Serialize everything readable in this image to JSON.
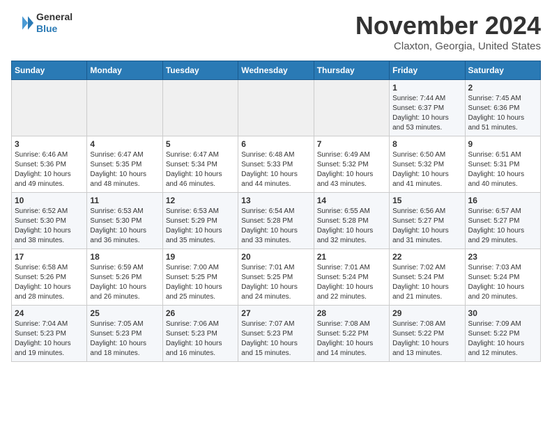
{
  "header": {
    "logo_line1": "General",
    "logo_line2": "Blue",
    "month": "November 2024",
    "location": "Claxton, Georgia, United States"
  },
  "weekdays": [
    "Sunday",
    "Monday",
    "Tuesday",
    "Wednesday",
    "Thursday",
    "Friday",
    "Saturday"
  ],
  "weeks": [
    [
      {
        "day": "",
        "empty": true
      },
      {
        "day": "",
        "empty": true
      },
      {
        "day": "",
        "empty": true
      },
      {
        "day": "",
        "empty": true
      },
      {
        "day": "",
        "empty": true
      },
      {
        "day": "1",
        "sunrise": "Sunrise: 7:44 AM",
        "sunset": "Sunset: 6:37 PM",
        "daylight": "Daylight: 10 hours and 53 minutes."
      },
      {
        "day": "2",
        "sunrise": "Sunrise: 7:45 AM",
        "sunset": "Sunset: 6:36 PM",
        "daylight": "Daylight: 10 hours and 51 minutes."
      }
    ],
    [
      {
        "day": "3",
        "sunrise": "Sunrise: 6:46 AM",
        "sunset": "Sunset: 5:36 PM",
        "daylight": "Daylight: 10 hours and 49 minutes."
      },
      {
        "day": "4",
        "sunrise": "Sunrise: 6:47 AM",
        "sunset": "Sunset: 5:35 PM",
        "daylight": "Daylight: 10 hours and 48 minutes."
      },
      {
        "day": "5",
        "sunrise": "Sunrise: 6:47 AM",
        "sunset": "Sunset: 5:34 PM",
        "daylight": "Daylight: 10 hours and 46 minutes."
      },
      {
        "day": "6",
        "sunrise": "Sunrise: 6:48 AM",
        "sunset": "Sunset: 5:33 PM",
        "daylight": "Daylight: 10 hours and 44 minutes."
      },
      {
        "day": "7",
        "sunrise": "Sunrise: 6:49 AM",
        "sunset": "Sunset: 5:32 PM",
        "daylight": "Daylight: 10 hours and 43 minutes."
      },
      {
        "day": "8",
        "sunrise": "Sunrise: 6:50 AM",
        "sunset": "Sunset: 5:32 PM",
        "daylight": "Daylight: 10 hours and 41 minutes."
      },
      {
        "day": "9",
        "sunrise": "Sunrise: 6:51 AM",
        "sunset": "Sunset: 5:31 PM",
        "daylight": "Daylight: 10 hours and 40 minutes."
      }
    ],
    [
      {
        "day": "10",
        "sunrise": "Sunrise: 6:52 AM",
        "sunset": "Sunset: 5:30 PM",
        "daylight": "Daylight: 10 hours and 38 minutes."
      },
      {
        "day": "11",
        "sunrise": "Sunrise: 6:53 AM",
        "sunset": "Sunset: 5:30 PM",
        "daylight": "Daylight: 10 hours and 36 minutes."
      },
      {
        "day": "12",
        "sunrise": "Sunrise: 6:53 AM",
        "sunset": "Sunset: 5:29 PM",
        "daylight": "Daylight: 10 hours and 35 minutes."
      },
      {
        "day": "13",
        "sunrise": "Sunrise: 6:54 AM",
        "sunset": "Sunset: 5:28 PM",
        "daylight": "Daylight: 10 hours and 33 minutes."
      },
      {
        "day": "14",
        "sunrise": "Sunrise: 6:55 AM",
        "sunset": "Sunset: 5:28 PM",
        "daylight": "Daylight: 10 hours and 32 minutes."
      },
      {
        "day": "15",
        "sunrise": "Sunrise: 6:56 AM",
        "sunset": "Sunset: 5:27 PM",
        "daylight": "Daylight: 10 hours and 31 minutes."
      },
      {
        "day": "16",
        "sunrise": "Sunrise: 6:57 AM",
        "sunset": "Sunset: 5:27 PM",
        "daylight": "Daylight: 10 hours and 29 minutes."
      }
    ],
    [
      {
        "day": "17",
        "sunrise": "Sunrise: 6:58 AM",
        "sunset": "Sunset: 5:26 PM",
        "daylight": "Daylight: 10 hours and 28 minutes."
      },
      {
        "day": "18",
        "sunrise": "Sunrise: 6:59 AM",
        "sunset": "Sunset: 5:26 PM",
        "daylight": "Daylight: 10 hours and 26 minutes."
      },
      {
        "day": "19",
        "sunrise": "Sunrise: 7:00 AM",
        "sunset": "Sunset: 5:25 PM",
        "daylight": "Daylight: 10 hours and 25 minutes."
      },
      {
        "day": "20",
        "sunrise": "Sunrise: 7:01 AM",
        "sunset": "Sunset: 5:25 PM",
        "daylight": "Daylight: 10 hours and 24 minutes."
      },
      {
        "day": "21",
        "sunrise": "Sunrise: 7:01 AM",
        "sunset": "Sunset: 5:24 PM",
        "daylight": "Daylight: 10 hours and 22 minutes."
      },
      {
        "day": "22",
        "sunrise": "Sunrise: 7:02 AM",
        "sunset": "Sunset: 5:24 PM",
        "daylight": "Daylight: 10 hours and 21 minutes."
      },
      {
        "day": "23",
        "sunrise": "Sunrise: 7:03 AM",
        "sunset": "Sunset: 5:24 PM",
        "daylight": "Daylight: 10 hours and 20 minutes."
      }
    ],
    [
      {
        "day": "24",
        "sunrise": "Sunrise: 7:04 AM",
        "sunset": "Sunset: 5:23 PM",
        "daylight": "Daylight: 10 hours and 19 minutes."
      },
      {
        "day": "25",
        "sunrise": "Sunrise: 7:05 AM",
        "sunset": "Sunset: 5:23 PM",
        "daylight": "Daylight: 10 hours and 18 minutes."
      },
      {
        "day": "26",
        "sunrise": "Sunrise: 7:06 AM",
        "sunset": "Sunset: 5:23 PM",
        "daylight": "Daylight: 10 hours and 16 minutes."
      },
      {
        "day": "27",
        "sunrise": "Sunrise: 7:07 AM",
        "sunset": "Sunset: 5:23 PM",
        "daylight": "Daylight: 10 hours and 15 minutes."
      },
      {
        "day": "28",
        "sunrise": "Sunrise: 7:08 AM",
        "sunset": "Sunset: 5:22 PM",
        "daylight": "Daylight: 10 hours and 14 minutes."
      },
      {
        "day": "29",
        "sunrise": "Sunrise: 7:08 AM",
        "sunset": "Sunset: 5:22 PM",
        "daylight": "Daylight: 10 hours and 13 minutes."
      },
      {
        "day": "30",
        "sunrise": "Sunrise: 7:09 AM",
        "sunset": "Sunset: 5:22 PM",
        "daylight": "Daylight: 10 hours and 12 minutes."
      }
    ]
  ]
}
